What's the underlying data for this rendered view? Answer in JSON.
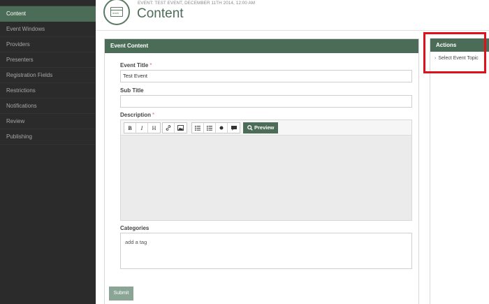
{
  "sidebar": {
    "items": [
      {
        "label": "Content",
        "active": true
      },
      {
        "label": "Event Windows"
      },
      {
        "label": "Providers"
      },
      {
        "label": "Presenters"
      },
      {
        "label": "Registration Fields"
      },
      {
        "label": "Restrictions"
      },
      {
        "label": "Notifications"
      },
      {
        "label": "Review"
      },
      {
        "label": "Publishing"
      }
    ]
  },
  "header": {
    "icon": "browser-window-icon",
    "icon_text": "www",
    "event_line": "EVENT: TEST EVENT, DECEMBER 11TH 2014, 12:00 AM",
    "title": "Content"
  },
  "event_content": {
    "panel_title": "Event Content",
    "event_title_label": "Event Title",
    "required_mark": "*",
    "event_title_value": "Test Event",
    "sub_title_label": "Sub Title",
    "sub_title_value": "",
    "description_label": "Description",
    "toolbar": {
      "bold": "B",
      "italic": "I",
      "heading": "H",
      "link_icon": "link-icon",
      "image_icon": "image-icon",
      "bullet_list_icon": "bullet-list-icon",
      "numbered_list_icon": "numbered-list-icon",
      "dot_icon": "circle-icon",
      "comment_icon": "comment-icon",
      "preview_label": "Preview"
    },
    "categories_label": "Categories",
    "categories_placeholder": "add a tag",
    "submit_label": "Submit"
  },
  "actions": {
    "title": "Actions",
    "items": [
      {
        "label": "Select Event Topic"
      }
    ]
  },
  "colors": {
    "brand_green": "#4b6d57",
    "sidebar_bg": "#2b2b2b",
    "highlight_red": "#e0111b",
    "required_pink": "#e06b7c"
  }
}
